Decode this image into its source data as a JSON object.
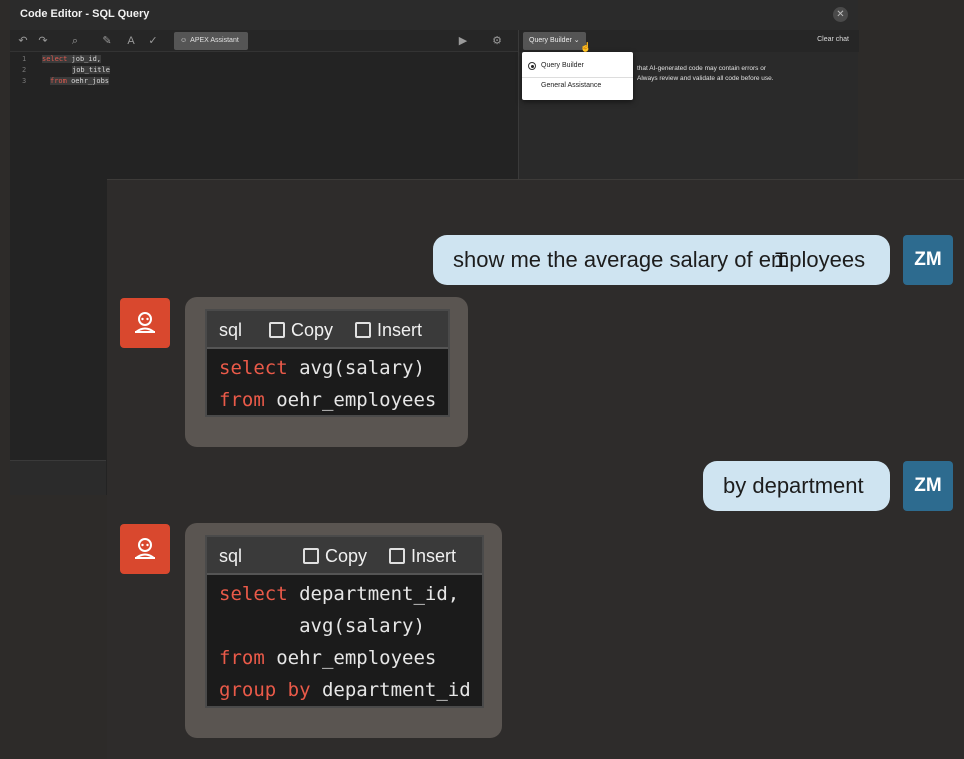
{
  "window": {
    "title": "Code Editor - SQL Query",
    "close_glyph": "✕"
  },
  "toolbar": {
    "undo_icon": "undo-icon",
    "redo_icon": "redo-icon",
    "search_icon": "search-icon",
    "wrench_icon": "wrench-icon",
    "format_icon": "text-case-icon",
    "validate_icon": "check-circle-icon",
    "assistant_label": "APEX Assistant",
    "run_icon": "play-icon",
    "settings_icon": "gear-icon"
  },
  "editor": {
    "line_numbers": [
      "1",
      "2",
      "3"
    ],
    "lines": [
      {
        "kw": "select",
        "rest": " job_id,"
      },
      {
        "kw": "",
        "rest": "job_title"
      },
      {
        "kw": "from",
        "rest": " oehr_jobs"
      }
    ]
  },
  "chat_panel": {
    "mode_label": "Query Builder",
    "clear_label": "Clear chat",
    "warning_text": "that AI-generated code may contain errors or",
    "warning_text2": "Always review and validate all code before use.",
    "mode_options": [
      "Query Builder",
      "General Assistance"
    ],
    "selected_mode": "Query Builder"
  },
  "conversation": [
    {
      "user_message": "show me the average salary of employees",
      "user_initials": "ZM",
      "response": {
        "language": "sql",
        "copy_label": "Copy",
        "insert_label": "Insert",
        "code_lines": [
          [
            {
              "t": "kw",
              "v": "select"
            },
            {
              "t": "id",
              "v": " avg(salary)"
            }
          ],
          [
            {
              "t": "kw",
              "v": "from"
            },
            {
              "t": "id",
              "v": " oehr_employees"
            }
          ]
        ]
      }
    },
    {
      "user_message": "by department",
      "user_initials": "ZM",
      "response": {
        "language": "sql",
        "copy_label": "Copy",
        "insert_label": "Insert",
        "code_lines": [
          [
            {
              "t": "kw",
              "v": "select"
            },
            {
              "t": "id",
              "v": " department_id,"
            }
          ],
          [
            {
              "t": "id",
              "v": "       avg(salary)"
            }
          ],
          [
            {
              "t": "kw",
              "v": "from"
            },
            {
              "t": "id",
              "v": " oehr_employees"
            }
          ],
          [
            {
              "t": "kw",
              "v": "group by"
            },
            {
              "t": "id",
              "v": " department_id"
            }
          ]
        ]
      }
    }
  ],
  "colors": {
    "keyword": "#ea5a49",
    "user_bubble": "#cfe4f1",
    "avatar": "#2d6b8f",
    "bot_avatar": "#d9482e"
  }
}
